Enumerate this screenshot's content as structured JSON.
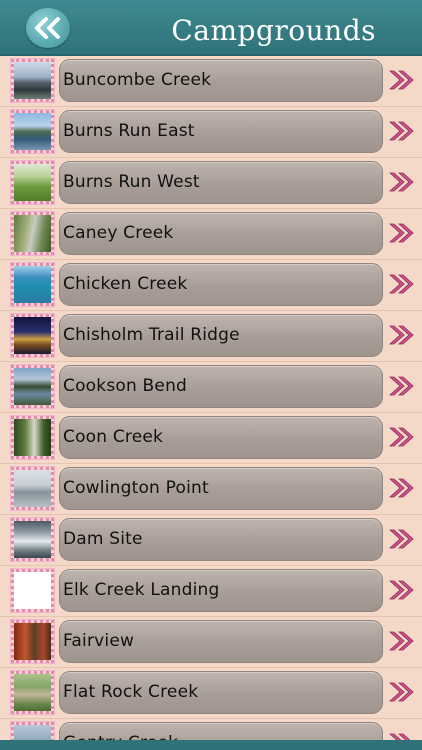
{
  "header": {
    "title": "Campgrounds",
    "back_icon": "double-chevron-left-icon"
  },
  "colors": {
    "header": "#2f7379",
    "background": "#f5d9c8",
    "pill": "#aaa099",
    "chevron": "#d24f8a",
    "thumb_border": "#e48ab1"
  },
  "items": [
    {
      "label": "Buncombe Creek",
      "thumb": "photo-lake-dock"
    },
    {
      "label": "Burns Run East",
      "thumb": "photo-lake-trees"
    },
    {
      "label": "Burns Run West",
      "thumb": "photo-green-field"
    },
    {
      "label": "Caney Creek",
      "thumb": "photo-creek-woods"
    },
    {
      "label": "Chicken Creek",
      "thumb": "photo-blue-water"
    },
    {
      "label": "Chisholm Trail Ridge",
      "thumb": "photo-night-lights"
    },
    {
      "label": "Cookson Bend",
      "thumb": "photo-lake-shore"
    },
    {
      "label": "Coon Creek",
      "thumb": "photo-forest"
    },
    {
      "label": "Cowlington Point",
      "thumb": "photo-misty-lake"
    },
    {
      "label": "Dam Site",
      "thumb": "photo-dam"
    },
    {
      "label": "Elk Creek Landing",
      "thumb": "photo-blank"
    },
    {
      "label": "Fairview",
      "thumb": "photo-autumn-trees"
    },
    {
      "label": "Flat Rock Creek",
      "thumb": "photo-picnic-shelter"
    },
    {
      "label": "Gentry Creek",
      "thumb": "photo-cabin"
    }
  ]
}
